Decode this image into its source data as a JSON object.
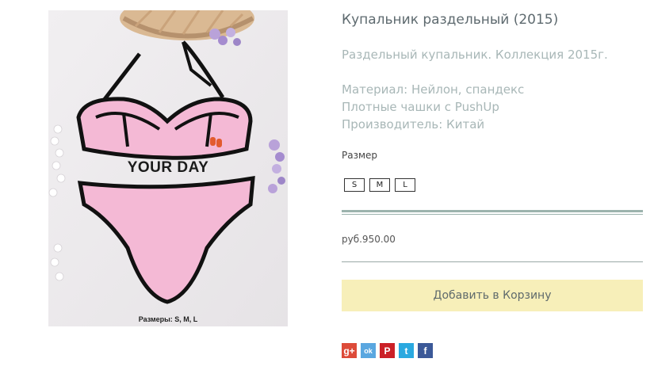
{
  "product": {
    "title": "Купальник раздельный (2015)",
    "description": [
      "Раздельный купальник. Коллекция 2015г.",
      "Материал: Нейлон, спандекс",
      "Плотные чашки с PushUp",
      "Производитель: Китай"
    ],
    "image": {
      "watermark": "YOUR DAY",
      "caption": "Размеры: S, M, L"
    },
    "size_label": "Размер",
    "sizes": [
      "S",
      "M",
      "L"
    ],
    "price": "руб.950.00",
    "add_to_cart_label": "Добавить в Корзину"
  },
  "share": [
    {
      "icon": "google-plus-icon",
      "glyph": "g+",
      "color": "#dd4b39"
    },
    {
      "icon": "odnoklassniki-icon",
      "glyph": "ok",
      "color": "#5aa7e0"
    },
    {
      "icon": "pinterest-icon",
      "glyph": "P",
      "color": "#cb2027"
    },
    {
      "icon": "twitter-icon",
      "glyph": "t",
      "color": "#2aa9e0"
    },
    {
      "icon": "facebook-icon",
      "glyph": "f",
      "color": "#3b5998"
    }
  ],
  "colors": {
    "cart_button": "#f7efb9",
    "rule": "#9cb3ad",
    "title": "#5e6a6f",
    "description": "#a8b7b7"
  }
}
